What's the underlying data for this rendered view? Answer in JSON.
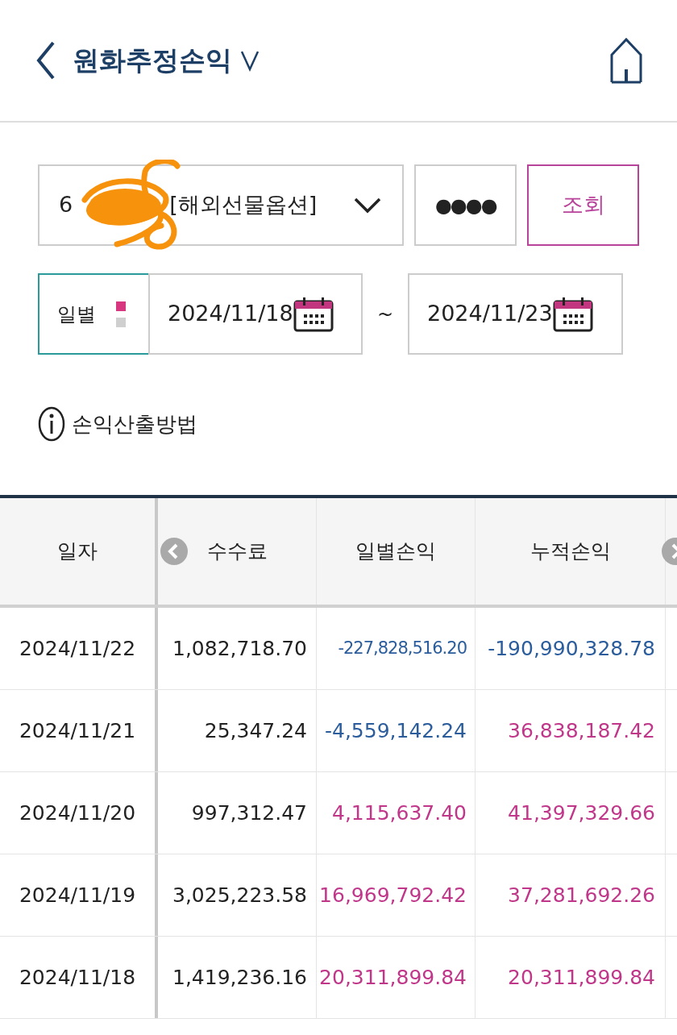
{
  "header": {
    "title": "원화추정손익"
  },
  "account": {
    "prefix": "6",
    "suffix": "[해외선물옵션]"
  },
  "password": {
    "value": "●●●●"
  },
  "search_button": "조회",
  "period": {
    "label": "일별",
    "dots": [
      {
        "selected": true
      },
      {
        "selected": false
      }
    ]
  },
  "date_from": "2024/11/18",
  "date_separator": "~",
  "date_to": "2024/11/23",
  "info_link": "손익산출방법",
  "table": {
    "columns": [
      "일자",
      "수수료",
      "일별손익",
      "누적손익"
    ],
    "rows": [
      {
        "date": "2024/11/22",
        "fee": "1,082,718.70",
        "daily": {
          "text": "-227,828,516.20",
          "color": "#2b5d9c"
        },
        "cumulative": {
          "text": "-190,990,328.78",
          "color": "#2b5d9c"
        }
      },
      {
        "date": "2024/11/21",
        "fee": "25,347.24",
        "daily": {
          "text": "-4,559,142.24",
          "color": "#2b5d9c"
        },
        "cumulative": {
          "text": "36,838,187.42",
          "color": "#c0378a"
        }
      },
      {
        "date": "2024/11/20",
        "fee": "997,312.47",
        "daily": {
          "text": "4,115,637.40",
          "color": "#c0378a"
        },
        "cumulative": {
          "text": "41,397,329.66",
          "color": "#c0378a"
        }
      },
      {
        "date": "2024/11/19",
        "fee": "3,025,223.58",
        "daily": {
          "text": "16,969,792.42",
          "color": "#c0378a"
        },
        "cumulative": {
          "text": "37,281,692.26",
          "color": "#c0378a"
        }
      },
      {
        "date": "2024/11/18",
        "fee": "1,419,236.16",
        "daily": {
          "text": "20,311,899.84",
          "color": "#c0378a"
        },
        "cumulative": {
          "text": "20,311,899.84",
          "color": "#c0378a"
        }
      }
    ]
  }
}
